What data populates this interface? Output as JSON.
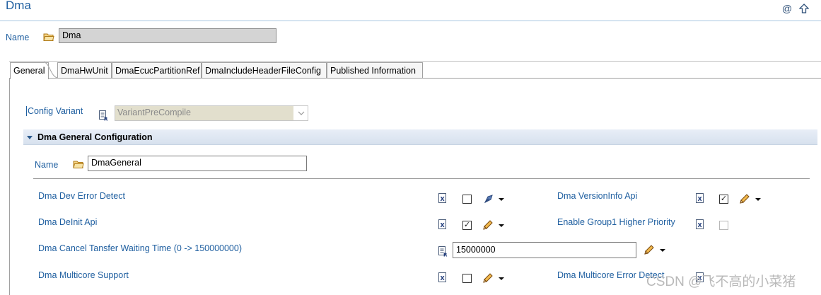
{
  "header": {
    "title": "Dma",
    "icons": [
      "at-icon",
      "up-arrow-icon"
    ]
  },
  "name_row": {
    "label": "Name",
    "value": "Dma"
  },
  "tabs": [
    {
      "label": "General",
      "active": true
    },
    {
      "label": "DmaHwUnit"
    },
    {
      "label": "DmaEcucPartitionRef"
    },
    {
      "label": "DmaIncludeHeaderFileConfig"
    },
    {
      "label": "Published Information"
    }
  ],
  "config_variant": {
    "label": "Config Variant",
    "value": "VariantPreCompile"
  },
  "section": {
    "title": "Dma General Configuration",
    "name_label": "Name",
    "name_value": "DmaGeneral"
  },
  "params": {
    "dev_error_detect": {
      "label": "Dma Dev Error Detect",
      "checked": false
    },
    "version_info_api": {
      "label": "Dma VersionInfo Api",
      "checked": true
    },
    "deinit_api": {
      "label": "Dma DeInit Api",
      "checked": true
    },
    "group1_higher_priority": {
      "label": "Enable Group1 Higher Priority",
      "checked": false,
      "disabled": true
    },
    "cancel_wait_time": {
      "label": "Dma Cancel Tansfer Waiting Time (0 -> 150000000)",
      "value": "15000000"
    },
    "multicore_support": {
      "label": "Dma Multicore Support",
      "checked": false
    },
    "multicore_error_detect": {
      "label": "Dma Multicore Error Detect"
    }
  },
  "watermark": "CSDN @飞不高的小菜猪",
  "colors": {
    "label_blue": "#1f5fa0",
    "section_bg": "#dfe7f2"
  }
}
